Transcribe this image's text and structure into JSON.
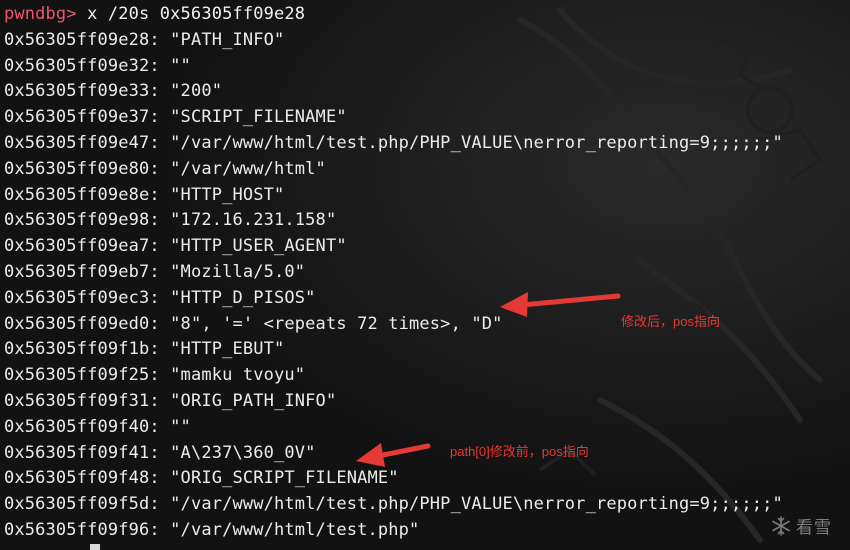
{
  "terminal": {
    "prompt": "pwndbg>",
    "command": " x /20s 0x56305ff09e28",
    "lines": [
      {
        "addr": "0x56305ff09e28:",
        "value": "\"PATH_INFO\""
      },
      {
        "addr": "0x56305ff09e32:",
        "value": "\"\""
      },
      {
        "addr": "0x56305ff09e33:",
        "value": "\"200\""
      },
      {
        "addr": "0x56305ff09e37:",
        "value": "\"SCRIPT_FILENAME\""
      },
      {
        "addr": "0x56305ff09e47:",
        "value": "\"/var/www/html/test.php/PHP_VALUE\\nerror_reporting=9;;;;;;\""
      },
      {
        "addr": "0x56305ff09e80:",
        "value": "\"/var/www/html\""
      },
      {
        "addr": "0x56305ff09e8e:",
        "value": "\"HTTP_HOST\""
      },
      {
        "addr": "0x56305ff09e98:",
        "value": "\"172.16.231.158\""
      },
      {
        "addr": "0x56305ff09ea7:",
        "value": "\"HTTP_USER_AGENT\""
      },
      {
        "addr": "0x56305ff09eb7:",
        "value": "\"Mozilla/5.0\""
      },
      {
        "addr": "0x56305ff09ec3:",
        "value": "\"HTTP_D_PISOS\""
      },
      {
        "addr": "0x56305ff09ed0:",
        "value": "\"8\", '=' <repeats 72 times>, \"D\""
      },
      {
        "addr": "0x56305ff09f1b:",
        "value": "\"HTTP_EBUT\""
      },
      {
        "addr": "0x56305ff09f25:",
        "value": "\"mamku tvoyu\""
      },
      {
        "addr": "0x56305ff09f31:",
        "value": "\"ORIG_PATH_INFO\""
      },
      {
        "addr": "0x56305ff09f40:",
        "value": "\"\""
      },
      {
        "addr": "0x56305ff09f41:",
        "value": "\"A\\237\\360_0V\""
      },
      {
        "addr": "0x56305ff09f48:",
        "value": "\"ORIG_SCRIPT_FILENAME\""
      },
      {
        "addr": "0x56305ff09f5d:",
        "value": "\"/var/www/html/test.php/PHP_VALUE\\nerror_reporting=9;;;;;;\""
      },
      {
        "addr": "0x56305ff09f96:",
        "value": "\"/var/www/html/test.php\""
      }
    ]
  },
  "annotations": {
    "after_label": "修改后，pos指向",
    "before_label": "path[0]修改前，pos指向"
  },
  "watermark": {
    "text": "看雪"
  },
  "colors": {
    "prompt": "#f0546a",
    "annotation": "#e53935",
    "background": "#141414",
    "text": "#ececec"
  }
}
